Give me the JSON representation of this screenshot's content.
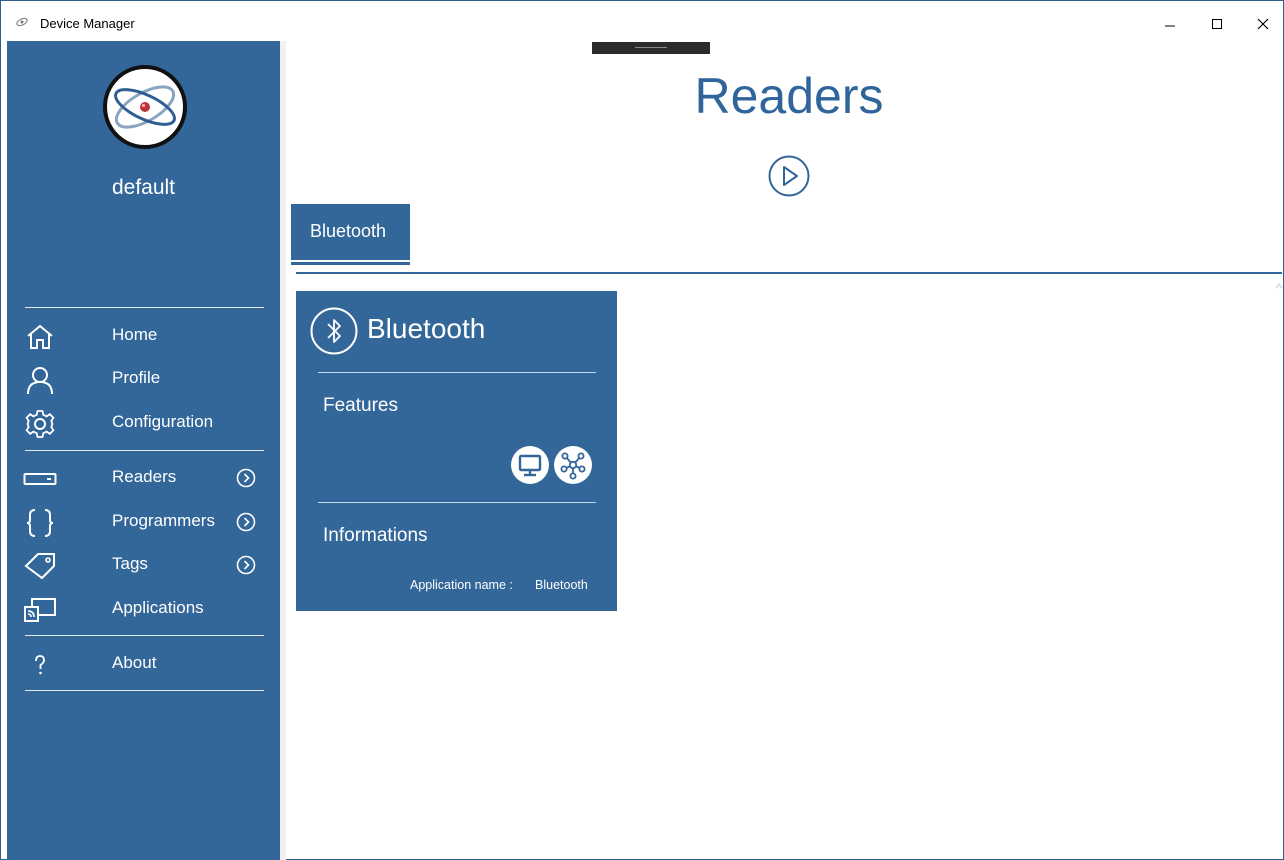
{
  "window": {
    "title": "Device Manager"
  },
  "sidebar": {
    "profile_name": "default",
    "groups": [
      [
        {
          "label": "Home",
          "icon": "home-icon"
        },
        {
          "label": "Profile",
          "icon": "user-icon"
        },
        {
          "label": "Configuration",
          "icon": "gear-icon"
        }
      ],
      [
        {
          "label": "Readers",
          "icon": "reader-device-icon",
          "has_arrow": true
        },
        {
          "label": "Programmers",
          "icon": "braces-icon",
          "has_arrow": true
        },
        {
          "label": "Tags",
          "icon": "tag-icon",
          "has_arrow": true
        },
        {
          "label": "Applications",
          "icon": "cast-screen-icon"
        }
      ],
      [
        {
          "label": "About",
          "icon": "question-icon"
        }
      ]
    ]
  },
  "main": {
    "title": "Readers",
    "tabs": [
      {
        "label": "Bluetooth",
        "selected": true
      }
    ],
    "card": {
      "title": "Bluetooth",
      "features_heading": "Features",
      "feature_icons": [
        "monitor-icon",
        "network-nodes-icon"
      ],
      "informations_heading": "Informations",
      "info": {
        "label": "Application name :",
        "value": "Bluetooth"
      }
    }
  },
  "colors": {
    "accent": "#336699",
    "title_text": "#2f659b",
    "background": "#ffffff"
  }
}
